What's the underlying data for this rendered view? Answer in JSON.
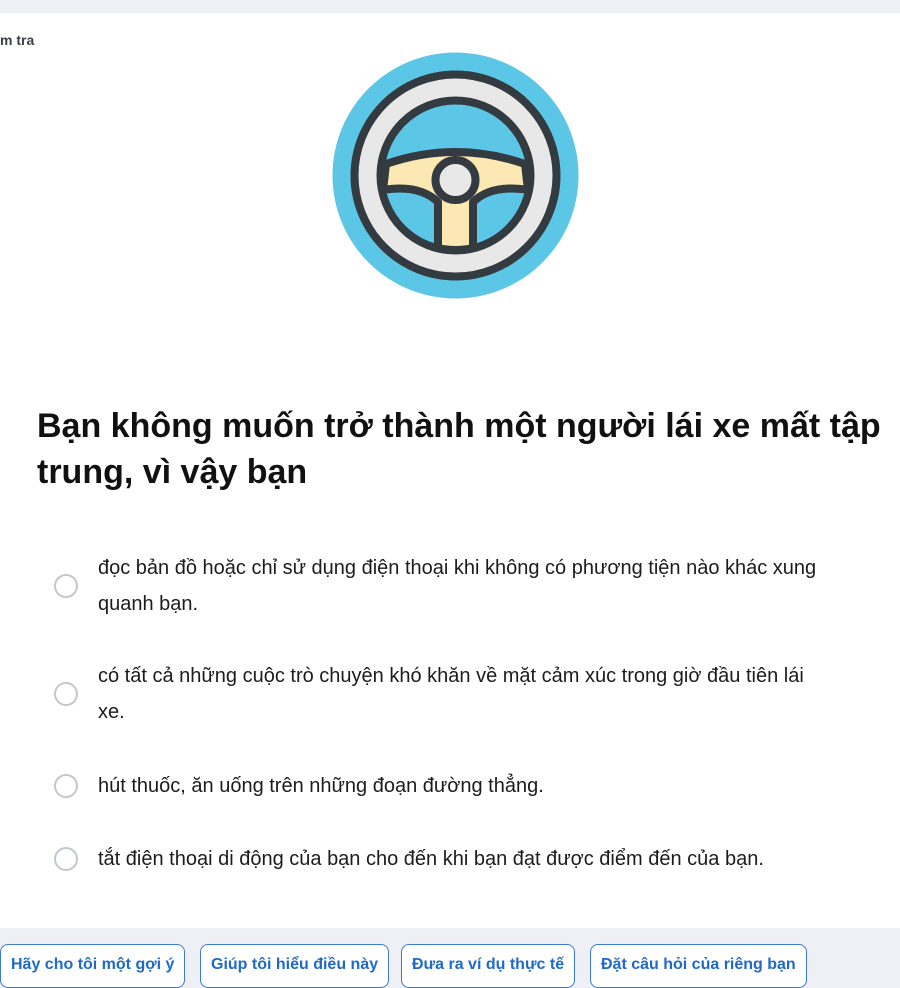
{
  "breadcrumb": "m tra",
  "illustration": {
    "icon": "steering-wheel-icon"
  },
  "question": "Bạn không muốn trở thành một người lái xe mất tập trung, vì vậy bạn",
  "options": [
    {
      "text": "đọc bản đồ hoặc chỉ sử dụng điện thoại khi không có phương tiện nào khác xung quanh bạn."
    },
    {
      "text": "có tất cả những cuộc trò chuyện khó khăn về mặt cảm xúc trong giờ đầu tiên lái xe."
    },
    {
      "text": "hút thuốc, ăn uống trên những đoạn đường thẳng."
    },
    {
      "text": "tắt điện thoại di động của bạn cho đến khi bạn đạt được điểm đến của bạn."
    }
  ],
  "help_buttons": [
    {
      "label": "Hãy cho tôi một gợi ý"
    },
    {
      "label": "Giúp tôi hiểu điều này"
    },
    {
      "label": "Đưa ra ví dụ thực tế"
    },
    {
      "label": "Đặt câu hỏi của riêng bạn"
    }
  ],
  "colors": {
    "background": "#eef0f5",
    "card": "#ffffff",
    "wheel_bg": "#5bc6e6",
    "wheel_rim": "#e8e8e8",
    "wheel_spokes": "#fce8b2",
    "outline": "#333a40",
    "accent": "#1f6ac8"
  }
}
